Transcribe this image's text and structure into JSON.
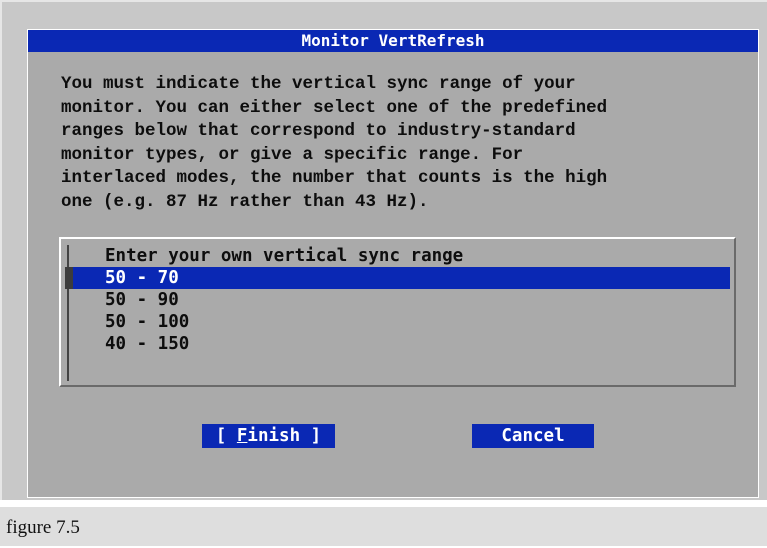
{
  "dialog": {
    "title": "Monitor VertRefresh",
    "message": "You must indicate the vertical sync range of your\nmonitor. You can either select one of the predefined\nranges below that correspond to industry-standard\nmonitor types, or give a specific range. For\ninterlaced modes, the number that counts is the high\none (e.g. 87 Hz rather than 43 Hz).",
    "list": {
      "items": [
        {
          "label": "Enter your own vertical sync range",
          "selected": false
        },
        {
          "label": "50 - 70",
          "selected": true
        },
        {
          "label": "50 - 90",
          "selected": false
        },
        {
          "label": "50 - 100",
          "selected": false
        },
        {
          "label": "40 - 150",
          "selected": false
        }
      ]
    },
    "buttons": {
      "finish_open": "[ ",
      "finish_hotkey": "F",
      "finish_rest": "inish ]",
      "cancel": "Cancel"
    }
  },
  "caption": "figure 7.5",
  "colors": {
    "highlight": "#0a28b4",
    "dialog_bg": "#aaaaaa",
    "text": "#0d0d0d"
  }
}
